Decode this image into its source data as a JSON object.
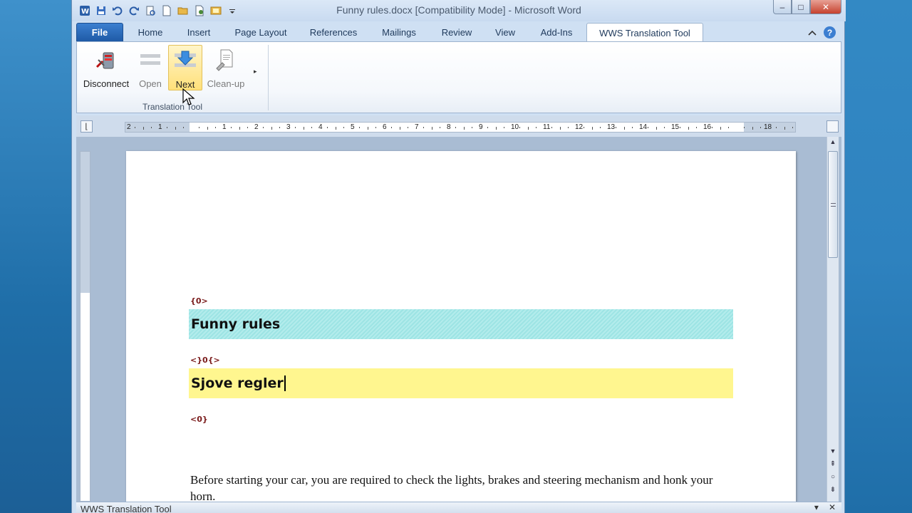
{
  "window": {
    "title": "Funny rules.docx [Compatibility Mode] - Microsoft Word",
    "controls": {
      "minimize": "–",
      "maximize": "□",
      "close": "✕"
    }
  },
  "quick_access": [
    "word-logo-icon",
    "save-icon",
    "undo-icon",
    "redo-icon",
    "print-preview-icon",
    "new-document-icon",
    "open-folder-icon",
    "email-icon",
    "image-icon",
    "customize-qat-icon"
  ],
  "tabs": [
    {
      "label": "File",
      "kind": "file"
    },
    {
      "label": "Home"
    },
    {
      "label": "Insert"
    },
    {
      "label": "Page Layout"
    },
    {
      "label": "References"
    },
    {
      "label": "Mailings"
    },
    {
      "label": "Review"
    },
    {
      "label": "View"
    },
    {
      "label": "Add-Ins"
    },
    {
      "label": "WWS Translation Tool",
      "active": true
    }
  ],
  "ribbon": {
    "buttons": {
      "disconnect": "Disconnect",
      "open": "Open",
      "next": "Next",
      "cleanup": "Clean-up"
    },
    "group_label": "Translation Tool"
  },
  "ruler": {
    "numbers": [
      "2",
      "1",
      "1",
      "2",
      "3",
      "4",
      "5",
      "6",
      "7",
      "8",
      "9",
      "10",
      "11",
      "12",
      "13",
      "14",
      "15",
      "16",
      "18"
    ]
  },
  "document": {
    "tag_open": "{0>",
    "source_segment": "Funny rules",
    "tag_mid": "<}0{>",
    "target_segment": "Sjove regler",
    "tag_close": "<0}",
    "body_text": "Before starting your car, you are required to check the lights, brakes and steering mechanism and honk your horn."
  },
  "task_pane": {
    "title": "WWS Translation Tool",
    "dropdown": "▾",
    "close": "✕"
  },
  "colors": {
    "source_highlight": "#9de4e4",
    "target_highlight": "#fff68f",
    "file_tab": "#2a66b8",
    "tag_text": "#7a1b1b"
  }
}
